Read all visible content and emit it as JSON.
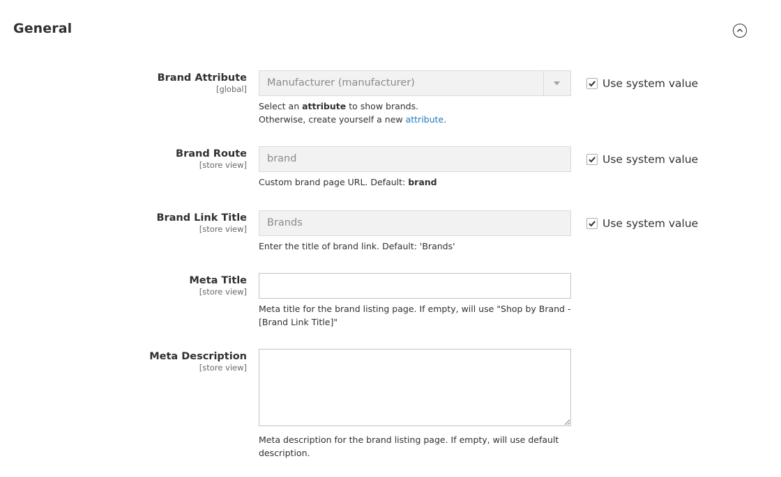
{
  "section": {
    "title": "General"
  },
  "fields": {
    "brand_attribute": {
      "label": "Brand Attribute",
      "scope": "[global]",
      "value": "Manufacturer (manufacturer)",
      "note_pre": "Select an ",
      "note_bold": "attribute",
      "note_mid": " to show brands.",
      "note_line2_pre": "Otherwise, create yourself a new ",
      "note_link": "attribute",
      "note_line2_post": ".",
      "system_value_label": "Use system value"
    },
    "brand_route": {
      "label": "Brand Route",
      "scope": "[store view]",
      "value": "brand",
      "note_pre": "Custom brand page URL. Default: ",
      "note_bold": "brand",
      "system_value_label": "Use system value"
    },
    "brand_link_title": {
      "label": "Brand Link Title",
      "scope": "[store view]",
      "value": "Brands",
      "note": "Enter the title of brand link. Default: 'Brands'",
      "system_value_label": "Use system value"
    },
    "meta_title": {
      "label": "Meta Title",
      "scope": "[store view]",
      "value": "",
      "note": "Meta title for the brand listing page. If empty, will use \"Shop by Brand - [Brand Link Title]\""
    },
    "meta_description": {
      "label": "Meta Description",
      "scope": "[store view]",
      "value": "",
      "note": "Meta description for the brand listing page. If empty, will use default description."
    }
  },
  "colors": {
    "text": "#303030",
    "link": "#1979c3",
    "disabled_bg": "#f2f2f2",
    "border": "#c2c2c2"
  },
  "icons": {
    "collapse": "chevron-up-circle-icon",
    "checkbox_checked": "check-icon",
    "select_arrow": "caret-down-icon"
  }
}
